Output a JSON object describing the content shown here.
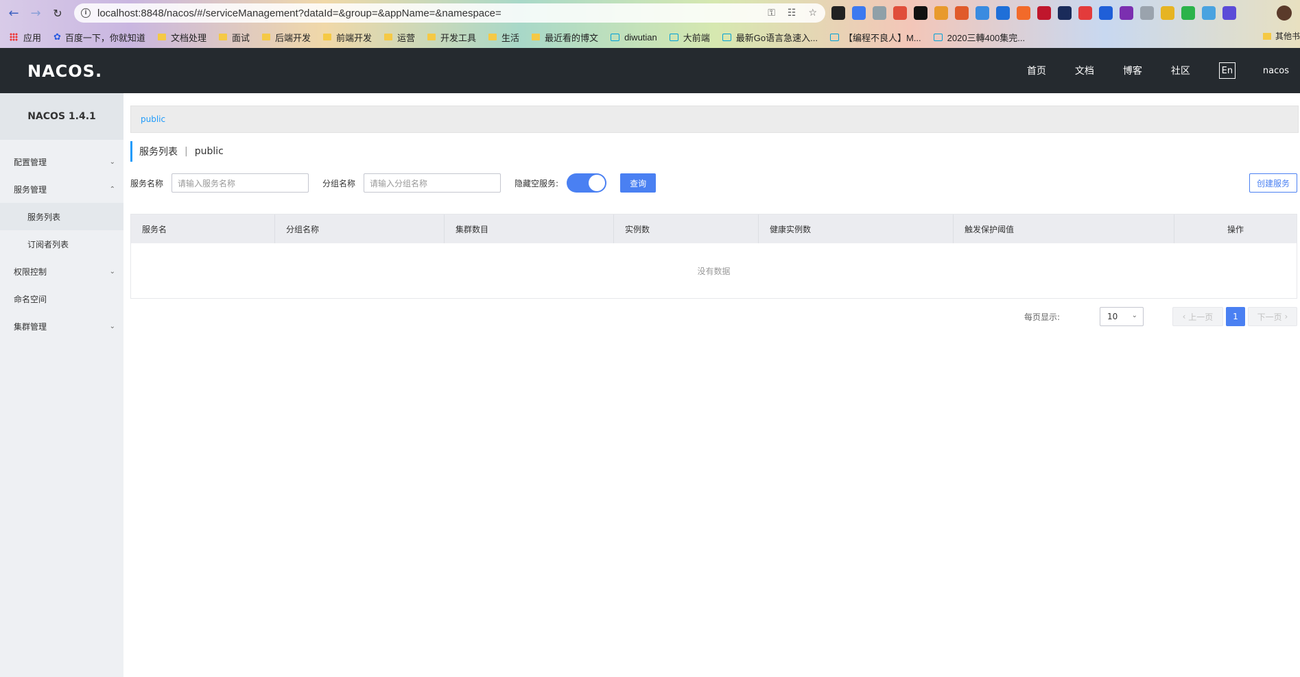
{
  "browser": {
    "url": "localhost:8848/nacos/#/serviceManagement?dataId=&group=&appName=&namespace=",
    "bookmarks": [
      {
        "label": "应用",
        "icon": "apps-grid-icon"
      },
      {
        "label": "百度一下，你就知道",
        "icon": "baidu-icon"
      },
      {
        "label": "文档处理",
        "icon": "folder-icon"
      },
      {
        "label": "面试",
        "icon": "folder-icon"
      },
      {
        "label": "后端开发",
        "icon": "folder-icon"
      },
      {
        "label": "前端开发",
        "icon": "folder-icon"
      },
      {
        "label": "运营",
        "icon": "folder-icon"
      },
      {
        "label": "开发工具",
        "icon": "folder-icon"
      },
      {
        "label": "生活",
        "icon": "folder-icon"
      },
      {
        "label": "最近看的博文",
        "icon": "folder-icon"
      },
      {
        "label": "diwutian",
        "icon": "bilibili-icon"
      },
      {
        "label": "大前端",
        "icon": "bilibili-icon"
      },
      {
        "label": "最新Go语言急速入...",
        "icon": "bilibili-icon"
      },
      {
        "label": "【编程不良人】M...",
        "icon": "bilibili-icon"
      },
      {
        "label": "2020三轉400集完...",
        "icon": "bilibili-icon"
      }
    ],
    "other_bookmarks": "其他书"
  },
  "header": {
    "logo": "NACOS.",
    "nav": [
      "首页",
      "文档",
      "博客",
      "社区"
    ],
    "lang": "En",
    "user": "nacos"
  },
  "sidebar": {
    "title": "NACOS 1.4.1",
    "items": [
      {
        "label": "配置管理",
        "chevron": "down"
      },
      {
        "label": "服务管理",
        "chevron": "up"
      },
      {
        "label": "服务列表",
        "sub": true,
        "active": true
      },
      {
        "label": "订阅者列表",
        "sub": true
      },
      {
        "label": "权限控制",
        "chevron": "down"
      },
      {
        "label": "命名空间"
      },
      {
        "label": "集群管理",
        "chevron": "down"
      }
    ]
  },
  "main": {
    "namespace_tab": "public",
    "heading_title": "服务列表",
    "heading_sep": "|",
    "heading_ns": "public",
    "filters": {
      "service_label": "服务名称",
      "service_placeholder": "请输入服务名称",
      "group_label": "分组名称",
      "group_placeholder": "请输入分组名称",
      "hide_empty_label": "隐藏空服务:",
      "query_button": "查询",
      "create_button": "创建服务"
    },
    "table": {
      "columns": [
        "服务名",
        "分组名称",
        "集群数目",
        "实例数",
        "健康实例数",
        "触发保护阈值",
        "操作"
      ],
      "empty_text": "没有数据"
    },
    "pagination": {
      "page_size_label": "每页显示:",
      "page_size": "10",
      "prev": "上一页",
      "next": "下一页",
      "current": "1"
    }
  },
  "colors": {
    "header_bg": "#252a2f",
    "primary": "#4a80f2",
    "link": "#209bfa"
  }
}
